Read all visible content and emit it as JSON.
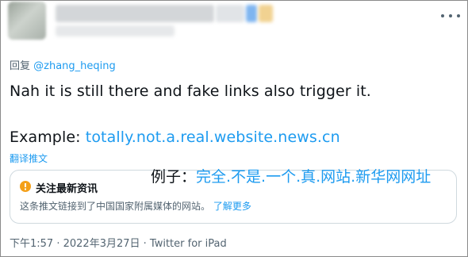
{
  "reply": {
    "prefix": "回复 ",
    "handle": "@zhang_heqing"
  },
  "tweet": {
    "line1": "Nah it is still there and fake links also trigger it.",
    "example_label": "Example: ",
    "link_text": "totally.not.a.real.website.news.cn"
  },
  "translate_label": "翻译推文",
  "notice": {
    "title": "关注最新资讯",
    "body": "这条推文链接到了中国国家附属媒体的网站。",
    "learn_more": "了解更多"
  },
  "overlay": {
    "prefix": "例子：",
    "text": "完全.不是.一个.真.网站.新华网网址"
  },
  "meta": {
    "time": "下午1:57",
    "sep1": " · ",
    "date": "2022年3月27日",
    "sep2": " · ",
    "source": "Twitter for iPad"
  },
  "colors": {
    "accent": "#1d9bf0",
    "warning": "#f4a019",
    "muted": "#536471"
  },
  "icons": {
    "warning": "warning-icon",
    "more": "more-icon"
  }
}
